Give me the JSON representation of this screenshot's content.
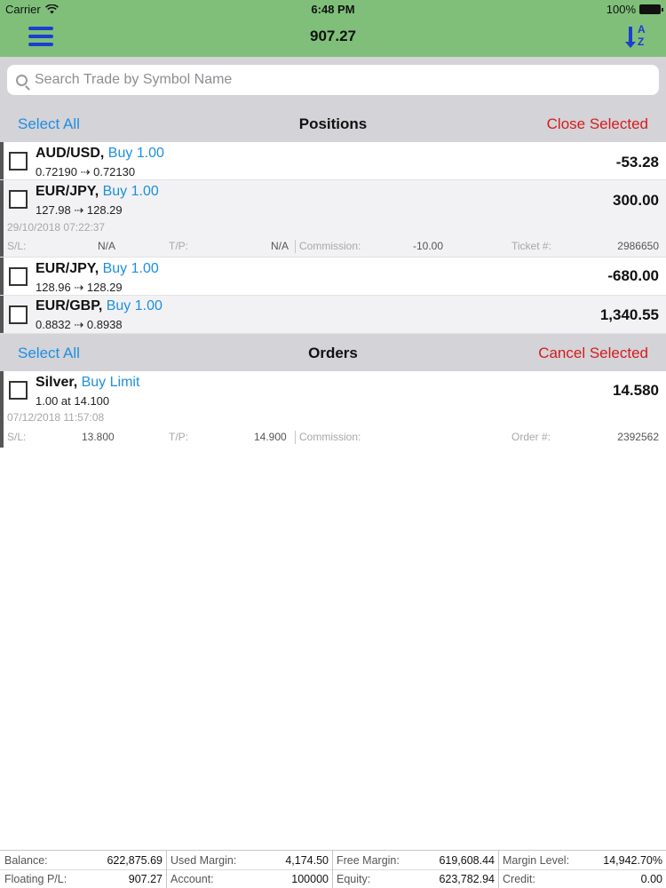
{
  "status_bar": {
    "carrier": "Carrier",
    "time": "6:48 PM",
    "battery": "100%"
  },
  "header": {
    "title": "907.27",
    "menu_icon": "hamburger-menu-icon",
    "sort_icon": "sort-az-icon"
  },
  "search": {
    "placeholder": "Search Trade by Symbol Name",
    "value": ""
  },
  "positions_section": {
    "select_all": "Select All",
    "title": "Positions",
    "close_selected": "Close Selected"
  },
  "positions": [
    {
      "symbol": "AUD/USD,",
      "side": "Buy 1.00",
      "prices": "0.72190 ⇢ 0.72130",
      "pl": "-53.28"
    },
    {
      "symbol": "EUR/JPY,",
      "side": "Buy 1.00",
      "prices": "127.98 ⇢ 128.29",
      "pl": "300.00",
      "timestamp": "29/10/2018 07:22:37",
      "sl_label": "S/L:",
      "sl": "N/A",
      "tp_label": "T/P:",
      "tp": "N/A",
      "commission_label": "Commission:",
      "commission": "-10.00",
      "ticket_label": "Ticket #:",
      "ticket": "2986650"
    },
    {
      "symbol": "EUR/JPY,",
      "side": "Buy 1.00",
      "prices": "128.96 ⇢ 128.29",
      "pl": "-680.00"
    },
    {
      "symbol": "EUR/GBP,",
      "side": "Buy 1.00",
      "prices": "0.8832 ⇢ 0.8938",
      "pl": "1,340.55"
    }
  ],
  "orders_section": {
    "select_all": "Select All",
    "title": "Orders",
    "cancel_selected": "Cancel Selected"
  },
  "orders": [
    {
      "symbol": "Silver,",
      "side": "Buy Limit",
      "prices": "1.00 at 14.100",
      "price": "14.580",
      "timestamp": "07/12/2018 11:57:08",
      "sl_label": "S/L:",
      "sl": "13.800",
      "tp_label": "T/P:",
      "tp": "14.900",
      "commission_label": "Commission:",
      "commission": "",
      "order_label": "Order #:",
      "order": "2392562"
    }
  ],
  "footer": {
    "balance_label": "Balance:",
    "balance": "622,875.69",
    "used_margin_label": "Used Margin:",
    "used_margin": "4,174.50",
    "free_margin_label": "Free Margin:",
    "free_margin": "619,608.44",
    "margin_level_label": "Margin Level:",
    "margin_level": "14,942.70%",
    "floating_pl_label": "Floating P/L:",
    "floating_pl": "907.27",
    "account_label": "Account:",
    "account": "100000",
    "equity_label": "Equity:",
    "equity": "623,782.94",
    "credit_label": "Credit:",
    "credit": "0.00"
  },
  "colors": {
    "header_bg": "#7fbf7a",
    "accent_blue": "#1e8fe0",
    "destructive_red": "#d41c1c",
    "icon_blue": "#1a3fd1"
  }
}
